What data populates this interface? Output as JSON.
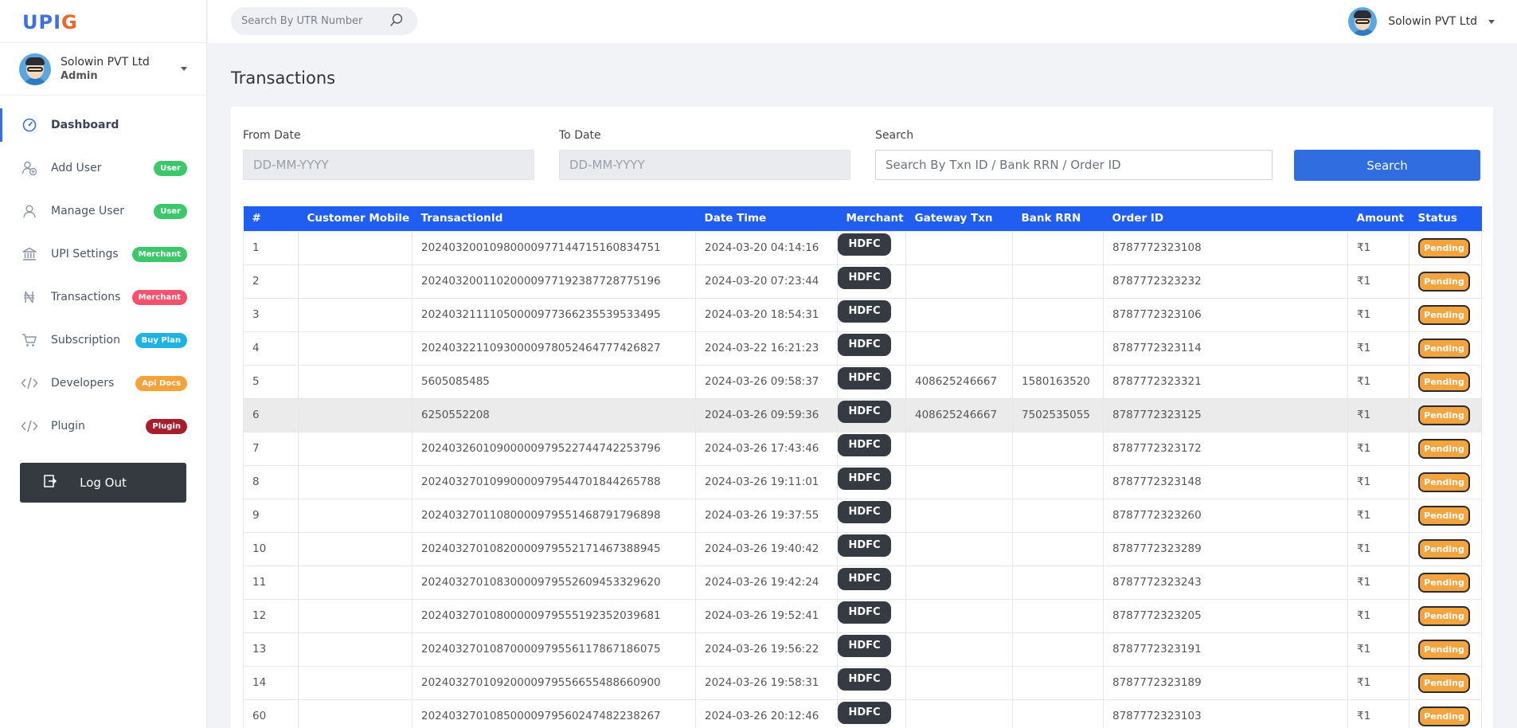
{
  "app": {
    "logo_part1": "UPI",
    "logo_part2": "G"
  },
  "sidebar": {
    "profile": {
      "name": "Solowin PVT Ltd",
      "role": "Admin"
    },
    "items": [
      {
        "label": "Dashboard",
        "icon": "dashboard-icon",
        "active": true
      },
      {
        "label": "Add User",
        "icon": "add-user-icon",
        "badge": "User",
        "badge_color": "#3cc76a"
      },
      {
        "label": "Manage User",
        "icon": "user-icon",
        "badge": "User",
        "badge_color": "#3cc76a"
      },
      {
        "label": "UPI Settings",
        "icon": "bank-icon",
        "badge": "Merchant",
        "badge_color": "#3cc76a"
      },
      {
        "label": "Transactions",
        "icon": "rupee-icon",
        "badge": "Merchant",
        "badge_color": "#f4516c"
      },
      {
        "label": "Subscription",
        "icon": "cart-icon",
        "badge": "Buy Plan",
        "badge_color": "#1fb3e3"
      },
      {
        "label": "Developers",
        "icon": "code-icon",
        "badge": "Api Docs",
        "badge_color": "#f5a23a"
      },
      {
        "label": "Plugin",
        "icon": "code-icon",
        "badge": "Plugin",
        "badge_color": "#a61e2b"
      }
    ],
    "logout_label": "Log Out"
  },
  "topbar": {
    "utr_placeholder": "Search By UTR Number",
    "user_name": "Solowin PVT Ltd"
  },
  "page": {
    "title": "Transactions",
    "filters": {
      "from_label": "From Date",
      "from_placeholder": "DD-MM-YYYY",
      "to_label": "To Date",
      "to_placeholder": "DD-MM-YYYY",
      "search_label": "Search",
      "search_placeholder": "Search By Txn ID / Bank RRN / Order ID",
      "search_button": "Search"
    }
  },
  "table": {
    "headers": [
      "#",
      "Customer Mobile",
      "TransactionId",
      "Date Time",
      "Merchant",
      "Gateway Txn",
      "Bank RRN",
      "Order ID",
      "Amount",
      "Status"
    ],
    "rows": [
      {
        "no": "1",
        "mobile": "",
        "txn": "20240320010980000977144715160834751",
        "dt": "2024-03-20 04:14:16",
        "merchant": "HDFC",
        "gateway": "",
        "rrn": "",
        "order": "8787772323108",
        "amount": "₹1",
        "status": "Pending"
      },
      {
        "no": "2",
        "mobile": "",
        "txn": "20240320011020000977192387728775196",
        "dt": "2024-03-20 07:23:44",
        "merchant": "HDFC",
        "gateway": "",
        "rrn": "",
        "order": "8787772323232",
        "amount": "₹1",
        "status": "Pending"
      },
      {
        "no": "3",
        "mobile": "",
        "txn": "20240321111050000977366235539533495",
        "dt": "2024-03-20 18:54:31",
        "merchant": "HDFC",
        "gateway": "",
        "rrn": "",
        "order": "8787772323106",
        "amount": "₹1",
        "status": "Pending"
      },
      {
        "no": "4",
        "mobile": "",
        "txn": "20240322110930000978052464777426827",
        "dt": "2024-03-22 16:21:23",
        "merchant": "HDFC",
        "gateway": "",
        "rrn": "",
        "order": "8787772323114",
        "amount": "₹1",
        "status": "Pending"
      },
      {
        "no": "5",
        "mobile": "",
        "txn": "5605085485",
        "dt": "2024-03-26 09:58:37",
        "merchant": "HDFC",
        "gateway": "408625246667",
        "rrn": "1580163520",
        "order": "8787772323321",
        "amount": "₹1",
        "status": "Pending"
      },
      {
        "no": "6",
        "mobile": "",
        "txn": "6250552208",
        "dt": "2024-03-26 09:59:36",
        "merchant": "HDFC",
        "gateway": "408625246667",
        "rrn": "7502535055",
        "order": "8787772323125",
        "amount": "₹1",
        "status": "Pending",
        "highlight": true
      },
      {
        "no": "7",
        "mobile": "",
        "txn": "20240326010900000979522744742253796",
        "dt": "2024-03-26 17:43:46",
        "merchant": "HDFC",
        "gateway": "",
        "rrn": "",
        "order": "8787772323172",
        "amount": "₹1",
        "status": "Pending"
      },
      {
        "no": "8",
        "mobile": "",
        "txn": "20240327010990000979544701844265788",
        "dt": "2024-03-26 19:11:01",
        "merchant": "HDFC",
        "gateway": "",
        "rrn": "",
        "order": "8787772323148",
        "amount": "₹1",
        "status": "Pending"
      },
      {
        "no": "9",
        "mobile": "",
        "txn": "20240327011080000979551468791796898",
        "dt": "2024-03-26 19:37:55",
        "merchant": "HDFC",
        "gateway": "",
        "rrn": "",
        "order": "8787772323260",
        "amount": "₹1",
        "status": "Pending"
      },
      {
        "no": "10",
        "mobile": "",
        "txn": "20240327010820000979552171467388945",
        "dt": "2024-03-26 19:40:42",
        "merchant": "HDFC",
        "gateway": "",
        "rrn": "",
        "order": "8787772323289",
        "amount": "₹1",
        "status": "Pending"
      },
      {
        "no": "11",
        "mobile": "",
        "txn": "20240327010830000979552609453329620",
        "dt": "2024-03-26 19:42:24",
        "merchant": "HDFC",
        "gateway": "",
        "rrn": "",
        "order": "8787772323243",
        "amount": "₹1",
        "status": "Pending"
      },
      {
        "no": "12",
        "mobile": "",
        "txn": "20240327010800000979555192352039681",
        "dt": "2024-03-26 19:52:41",
        "merchant": "HDFC",
        "gateway": "",
        "rrn": "",
        "order": "8787772323205",
        "amount": "₹1",
        "status": "Pending"
      },
      {
        "no": "13",
        "mobile": "",
        "txn": "20240327010870000979556117867186075",
        "dt": "2024-03-26 19:56:22",
        "merchant": "HDFC",
        "gateway": "",
        "rrn": "",
        "order": "8787772323191",
        "amount": "₹1",
        "status": "Pending"
      },
      {
        "no": "14",
        "mobile": "",
        "txn": "20240327010920000979556655488660900",
        "dt": "2024-03-26 19:58:31",
        "merchant": "HDFC",
        "gateway": "",
        "rrn": "",
        "order": "8787772323189",
        "amount": "₹1",
        "status": "Pending"
      },
      {
        "no": "60",
        "mobile": "",
        "txn": "20240327010850000979560247482238267",
        "dt": "2024-03-26 20:12:46",
        "merchant": "HDFC",
        "gateway": "",
        "rrn": "",
        "order": "8787772323103",
        "amount": "₹1",
        "status": "Pending"
      }
    ]
  },
  "colors": {
    "primary": "#2f6de1",
    "table_header": "#1f5ef0",
    "merchant_badge": "#363b43",
    "pending": "#f4a43e"
  }
}
